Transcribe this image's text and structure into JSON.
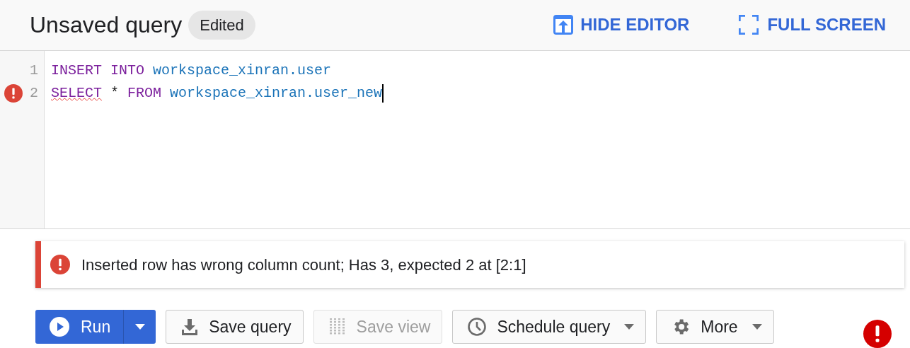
{
  "header": {
    "title": "Unsaved query",
    "badge": "Edited",
    "actions": [
      "HIDE EDITOR",
      "FULL SCREEN"
    ]
  },
  "editor": {
    "lines": [
      {
        "number": "1",
        "error": false,
        "cursor": false,
        "tokens": [
          {
            "text": "INSERT",
            "kind": "keyword",
            "error": false
          },
          {
            "text": "INTO",
            "kind": "keyword",
            "error": false
          },
          {
            "text": "workspace_xinran.user",
            "kind": "identifier",
            "error": false
          }
        ]
      },
      {
        "number": "2",
        "error": true,
        "cursor": true,
        "tokens": [
          {
            "text": "SELECT",
            "kind": "keyword",
            "error": true
          },
          {
            "text": "*",
            "kind": "plain",
            "error": false
          },
          {
            "text": "FROM",
            "kind": "keyword",
            "error": false
          },
          {
            "text": "workspace_xinran.user_new",
            "kind": "identifier",
            "error": false
          }
        ]
      }
    ]
  },
  "error_banner": {
    "message": "Inserted row has wrong column count; Has 3, expected 2 at [2:1]"
  },
  "toolbar": {
    "buttons": [
      {
        "label": "Run",
        "kind": "primary",
        "disabled": false,
        "dropdown": true
      },
      {
        "label": "Save query",
        "kind": "default",
        "disabled": false,
        "dropdown": false
      },
      {
        "label": "Save view",
        "kind": "default",
        "disabled": true,
        "dropdown": false
      },
      {
        "label": "Schedule query",
        "kind": "default",
        "disabled": false,
        "dropdown": true
      },
      {
        "label": "More",
        "kind": "default",
        "disabled": false,
        "dropdown": true
      }
    ]
  }
}
